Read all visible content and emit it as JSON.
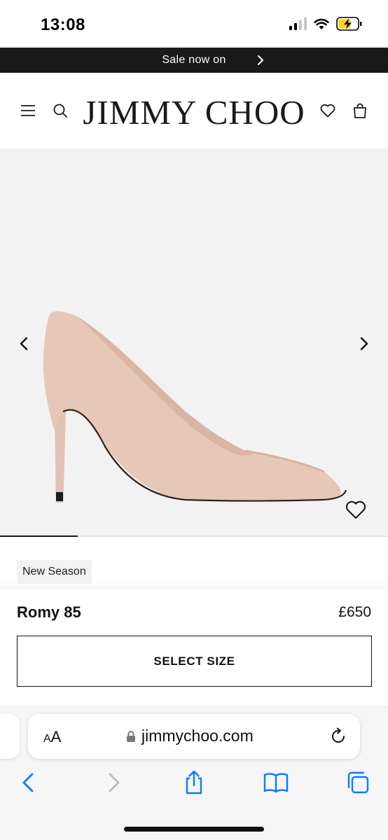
{
  "status_bar": {
    "time": "13:08",
    "battery_icon": "battery-charging-icon"
  },
  "banner": {
    "text": "Sale now on"
  },
  "header": {
    "logo": "JIMMY CHOO"
  },
  "gallery": {
    "progress": 0.2
  },
  "product": {
    "badge": "New Season",
    "name": "Romy 85",
    "price": "£650",
    "select_label": "SELECT SIZE"
  },
  "browser": {
    "aa_large": "A",
    "aa_small": "A",
    "url": "jimmychoo.com"
  },
  "colors": {
    "banner_bg": "#1a1a1a",
    "gallery_bg": "#f2f2f3",
    "ios_blue": "#0a7aff",
    "battery_yellow": "#ffd60a"
  }
}
